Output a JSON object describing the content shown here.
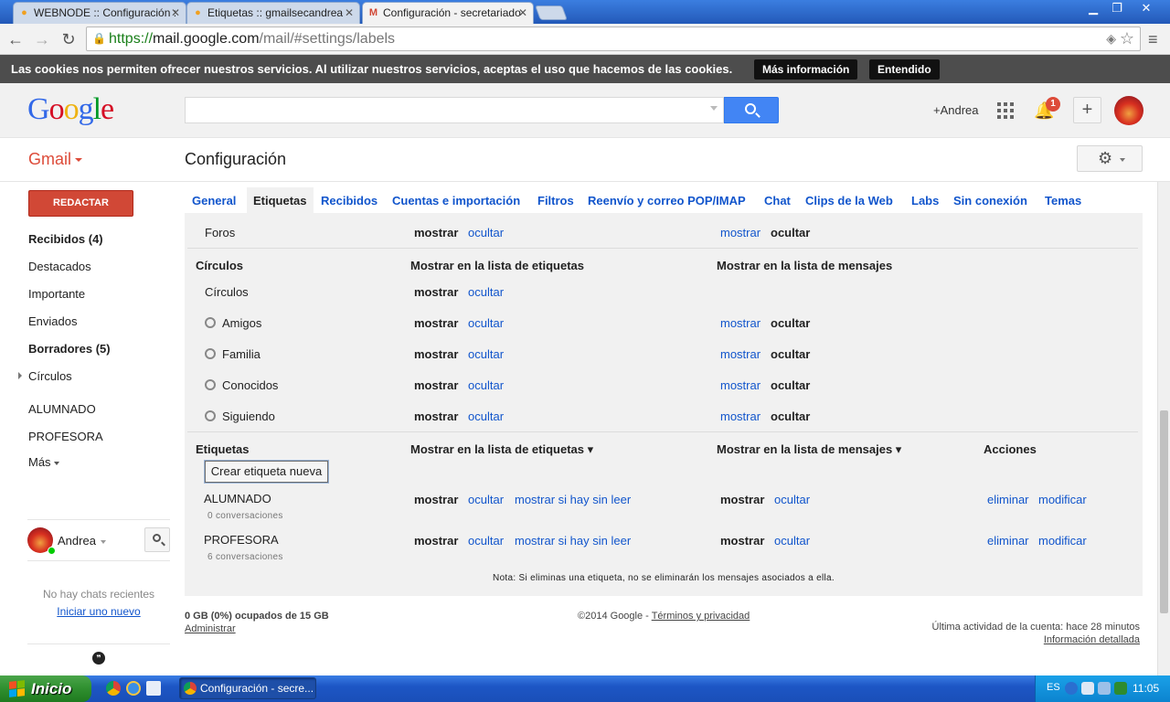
{
  "browser": {
    "tabs": [
      {
        "title": "WEBNODE :: Configuración :",
        "active": false
      },
      {
        "title": "Etiquetas :: gmailsecandrea",
        "active": false
      },
      {
        "title": "Configuración - secretariado",
        "active": true
      }
    ],
    "url_scheme": "https://",
    "url_host": "mail.google.com",
    "url_path": "/mail/#settings/labels"
  },
  "cookie_bar": {
    "text": "Las cookies nos permiten ofrecer nuestros servicios. Al utilizar nuestros servicios, aceptas el uso que hacemos de las cookies.",
    "more_info": "Más información",
    "ok": "Entendido"
  },
  "header": {
    "logo_letters": [
      "G",
      "o",
      "o",
      "g",
      "l",
      "e"
    ],
    "user_link": "+Andrea",
    "notification_count": "1"
  },
  "gmail_bar": {
    "app_label": "Gmail",
    "page_title": "Configuración"
  },
  "sidebar": {
    "compose": "REDACTAR",
    "items": [
      {
        "label": "Recibidos (4)",
        "bold": true
      },
      {
        "label": "Destacados",
        "bold": false
      },
      {
        "label": "Importante",
        "bold": false
      },
      {
        "label": "Enviados",
        "bold": false
      },
      {
        "label": "Borradores (5)",
        "bold": true
      },
      {
        "label": "Círculos",
        "bold": false
      },
      {
        "label": "ALUMNADO",
        "bold": false
      },
      {
        "label": "PROFESORA",
        "bold": false
      },
      {
        "label": "Más",
        "bold": false
      }
    ],
    "chat_user": "Andrea",
    "no_chats": "No hay chats recientes",
    "start_new": "Iniciar uno nuevo"
  },
  "settings_tabs": [
    "General",
    "Etiquetas",
    "Recibidos",
    "Cuentas e importación",
    "Filtros",
    "Reenvío y correo POP/IMAP",
    "Chat",
    "Clips de la Web",
    "Labs",
    "Sin conexión",
    "Temas"
  ],
  "labels_panel": {
    "show": "mostrar",
    "hide": "ocultar",
    "show_if_unread": "mostrar si hay sin leer",
    "delete": "eliminar",
    "edit": "modificar",
    "forums_row": {
      "name": "Foros"
    },
    "circles_section": {
      "header": "Círculos",
      "col_labels": "Mostrar en la lista de etiquetas",
      "col_messages": "Mostrar en la lista de mensajes",
      "group_name": "Círculos",
      "circles": [
        "Amigos",
        "Familia",
        "Conocidos",
        "Siguiendo"
      ]
    },
    "labels_section": {
      "header": "Etiquetas",
      "col_labels": "Mostrar en la lista de etiquetas ▾",
      "col_messages": "Mostrar en la lista de mensajes ▾",
      "col_actions": "Acciones",
      "create_button": "Crear etiqueta nueva",
      "labels": [
        {
          "name": "ALUMNADO",
          "count": "0 conversaciones"
        },
        {
          "name": "PROFESORA",
          "count": "6 conversaciones"
        }
      ]
    },
    "note": "Nota: Si eliminas una etiqueta, no se eliminarán los mensajes asociados a ella."
  },
  "footer": {
    "storage": "0 GB (0%) ocupados de 15 GB",
    "manage": "Administrar",
    "copyright": "©2014 Google - ",
    "terms": "Términos y privacidad",
    "last_activity": "Última actividad de la cuenta: hace 28 minutos",
    "details": "Información detallada"
  },
  "taskbar": {
    "start": "Inicio",
    "task": "Configuración - secre...",
    "lang": "ES",
    "clock": "11:05"
  },
  "colors": {
    "link": "#1155cc",
    "compose": "#d14836",
    "gmail_red": "#dd4b39",
    "search_blue": "#4285f4"
  }
}
